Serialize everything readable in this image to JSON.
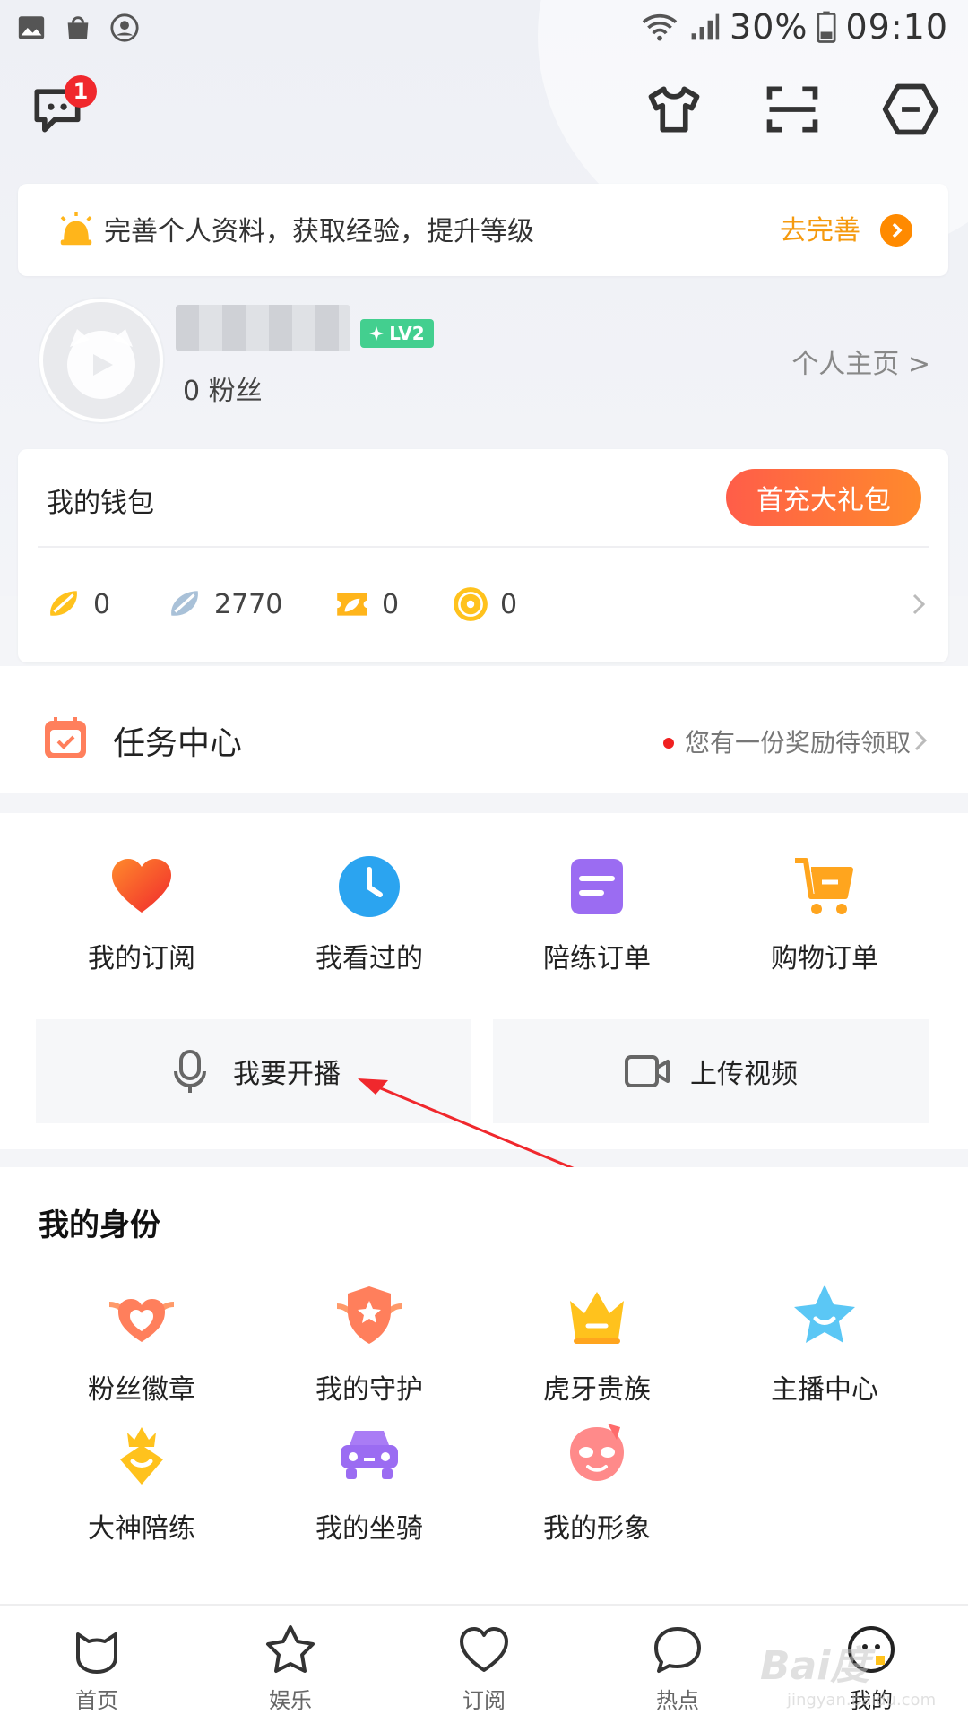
{
  "status_bar": {
    "battery": "30%",
    "time": "09:10"
  },
  "header": {
    "notification_count": "1"
  },
  "tip": {
    "text": "完善个人资料，获取经验，提升等级",
    "link": "去完善"
  },
  "profile": {
    "level": "LV2",
    "fans": "0 粉丝",
    "homepage": "个人主页 >"
  },
  "wallet": {
    "title": "我的钱包",
    "promo_button": "首充大礼包",
    "balances": [
      {
        "icon": "gold-bean-icon",
        "value": "0"
      },
      {
        "icon": "silver-bean-icon",
        "value": "2770"
      },
      {
        "icon": "coupon-icon",
        "value": "0"
      },
      {
        "icon": "coin-icon",
        "value": "0"
      }
    ]
  },
  "task_center": {
    "title": "任务中心",
    "note": "您有一份奖励待领取"
  },
  "shortcuts": [
    {
      "label": "我的订阅",
      "icon": "heart-icon",
      "color": "#ff5a3a"
    },
    {
      "label": "我看过的",
      "icon": "clock-icon",
      "color": "#2ba4f0"
    },
    {
      "label": "陪练订单",
      "icon": "order-doc-icon",
      "color": "#9b6cf2"
    },
    {
      "label": "购物订单",
      "icon": "cart-icon",
      "color": "#ffa51e"
    }
  ],
  "actions": {
    "broadcast": "我要开播",
    "upload": "上传视频"
  },
  "identity": {
    "title": "我的身份",
    "items": [
      {
        "label": "粉丝徽章",
        "icon": "fan-badge-icon"
      },
      {
        "label": "我的守护",
        "icon": "guard-shield-icon"
      },
      {
        "label": "虎牙贵族",
        "icon": "noble-crown-icon"
      },
      {
        "label": "主播中心",
        "icon": "star-icon"
      },
      {
        "label": "大神陪练",
        "icon": "master-coach-icon"
      },
      {
        "label": "我的坐骑",
        "icon": "car-icon"
      },
      {
        "label": "我的形象",
        "icon": "avatar-face-icon"
      }
    ]
  },
  "bottom_nav": [
    {
      "label": "首页"
    },
    {
      "label": "娱乐"
    },
    {
      "label": "订阅"
    },
    {
      "label": "热点"
    },
    {
      "label": "我的"
    }
  ],
  "watermark": {
    "line1": "Bai度",
    "line2": "jingyan.baidu.com"
  }
}
